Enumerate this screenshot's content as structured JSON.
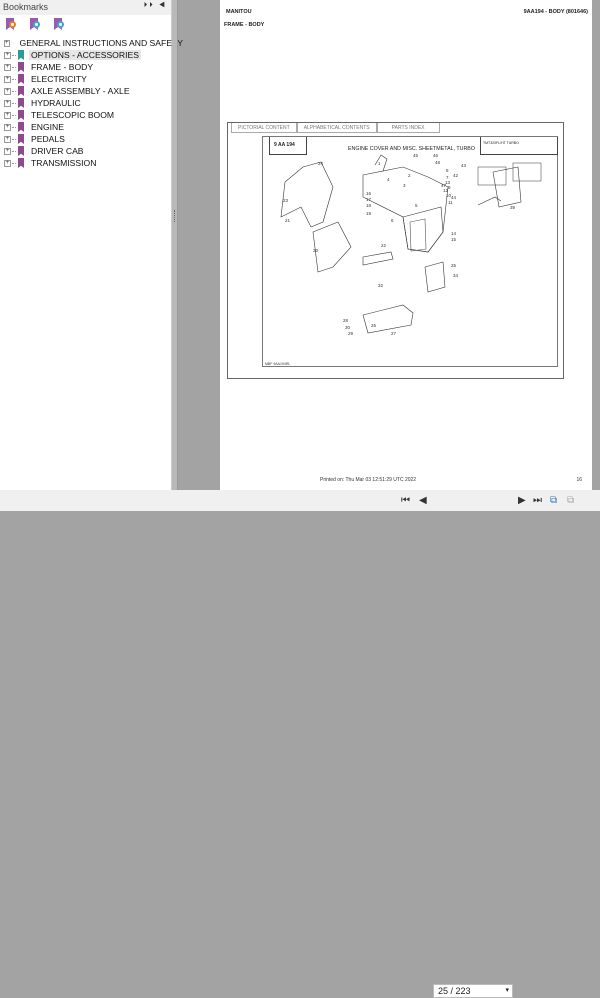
{
  "bookmarks": {
    "title": "Bookmarks",
    "items": [
      {
        "label": "GENERAL INSTRUCTIONS AND SAFETY"
      },
      {
        "label": "OPTIONS - ACCESSORIES",
        "selected": true
      },
      {
        "label": "FRAME - BODY"
      },
      {
        "label": "ELECTRICITY"
      },
      {
        "label": "AXLE ASSEMBLY - AXLE"
      },
      {
        "label": "HYDRAULIC"
      },
      {
        "label": "TELESCOPIC BOOM"
      },
      {
        "label": "ENGINE"
      },
      {
        "label": "PEDALS"
      },
      {
        "label": "DRIVER CAB"
      },
      {
        "label": "TRANSMISSION"
      }
    ]
  },
  "page": {
    "brand": "MANITOU",
    "section": "FRAME - BODY",
    "ref": "9AA194 - BODY (801646)",
    "tabs": [
      "PICTORIAL CONTENT",
      "ALPHABETICAL CONTENTS",
      "PARTS INDEX"
    ],
    "code": "9 AA 194",
    "figure_title": "ENGINE COVER AND MISC. SHEETMETAL, TURBO",
    "model": "TMT320FL/HT TURBO",
    "callouts": [
      "1",
      "2",
      "3",
      "4",
      "5",
      "6",
      "7",
      "8",
      "9",
      "10",
      "11",
      "12",
      "13",
      "14",
      "15",
      "16",
      "17",
      "18",
      "19",
      "20",
      "21",
      "22",
      "23",
      "24",
      "25",
      "26",
      "27",
      "28",
      "29",
      "30",
      "32",
      "34",
      "39",
      "42",
      "43",
      "44",
      "45",
      "46",
      "47",
      "48"
    ],
    "footer": "Printed on:  Thu Mar 03 12:51:29 UTC 2022",
    "page_number": "16"
  },
  "toolbar": {
    "page_indicator": "25 / 223"
  }
}
